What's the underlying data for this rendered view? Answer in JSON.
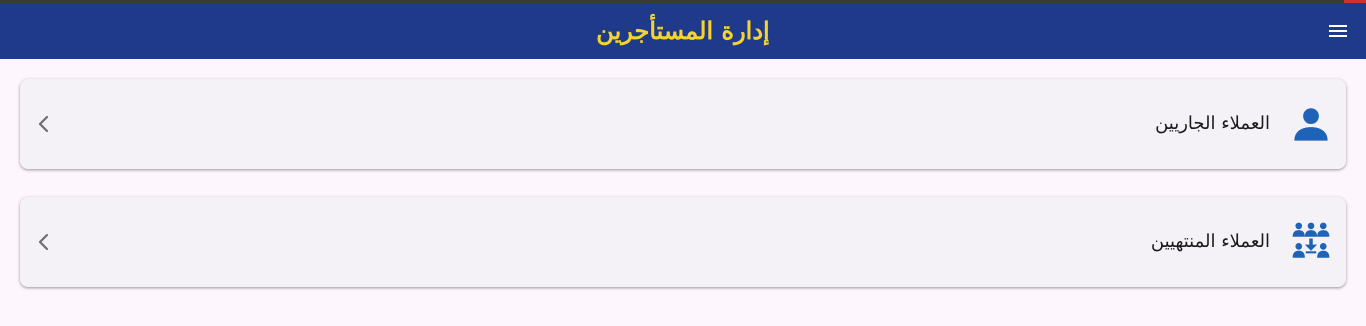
{
  "app_bar": {
    "title": "إدارة المستأجرين",
    "menu_icon": "hamburger-menu-icon",
    "background_color": "#1f3a8a",
    "title_color": "#f6d32d"
  },
  "menu": {
    "items": [
      {
        "label": "العملاء الجاريين",
        "icon": "person-icon",
        "trailing_icon": "chevron-left-icon"
      },
      {
        "label": "العملاء المنتهيين",
        "icon": "groups-archive-icon",
        "trailing_icon": "chevron-left-icon"
      }
    ],
    "icon_color": "#1e63b8"
  }
}
